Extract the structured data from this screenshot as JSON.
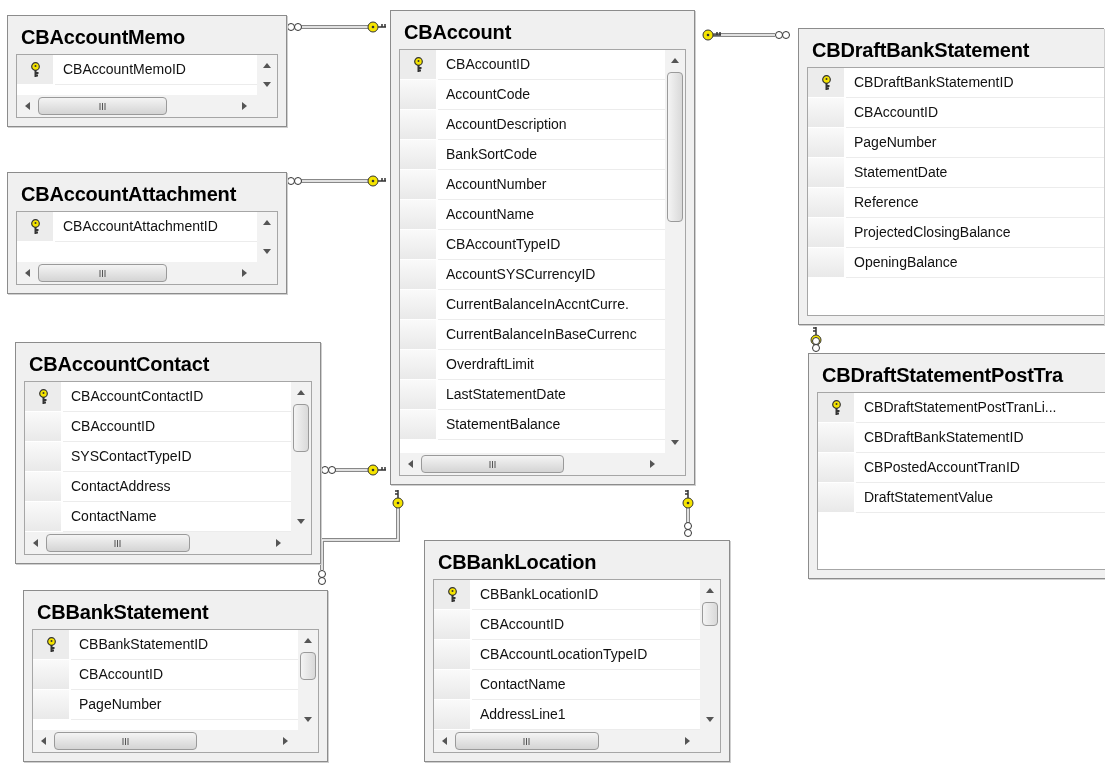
{
  "tables": [
    {
      "name": "CBAccountMemo",
      "scrollable": true,
      "columns": [
        {
          "name": "CBAccountMemoID",
          "key": true
        }
      ]
    },
    {
      "name": "CBAccountAttachment",
      "scrollable": true,
      "columns": [
        {
          "name": "CBAccountAttachmentID",
          "key": true
        }
      ]
    },
    {
      "name": "CBAccountContact",
      "scrollable": true,
      "columns": [
        {
          "name": "CBAccountContactID",
          "key": true
        },
        {
          "name": "CBAccountID",
          "key": false
        },
        {
          "name": "SYSContactTypeID",
          "key": false
        },
        {
          "name": "ContactAddress",
          "key": false
        },
        {
          "name": "ContactName",
          "key": false
        }
      ]
    },
    {
      "name": "CBBankStatement",
      "scrollable": true,
      "columns": [
        {
          "name": "CBBankStatementID",
          "key": true
        },
        {
          "name": "CBAccountID",
          "key": false
        },
        {
          "name": "PageNumber",
          "key": false
        }
      ]
    },
    {
      "name": "CBAccount",
      "scrollable": true,
      "columns": [
        {
          "name": "CBAccountID",
          "key": true
        },
        {
          "name": "AccountCode",
          "key": false
        },
        {
          "name": "AccountDescription",
          "key": false
        },
        {
          "name": "BankSortCode",
          "key": false
        },
        {
          "name": "AccountNumber",
          "key": false
        },
        {
          "name": "AccountName",
          "key": false
        },
        {
          "name": "CBAccountTypeID",
          "key": false
        },
        {
          "name": "AccountSYSCurrencyID",
          "key": false
        },
        {
          "name": "CurrentBalanceInAccntCurre.",
          "key": false
        },
        {
          "name": "CurrentBalanceInBaseCurrenc",
          "key": false
        },
        {
          "name": "OverdraftLimit",
          "key": false
        },
        {
          "name": "LastStatementDate",
          "key": false
        },
        {
          "name": "StatementBalance",
          "key": false
        }
      ]
    },
    {
      "name": "CBBankLocation",
      "scrollable": true,
      "columns": [
        {
          "name": "CBBankLocationID",
          "key": true
        },
        {
          "name": "CBAccountID",
          "key": false
        },
        {
          "name": "CBAccountLocationTypeID",
          "key": false
        },
        {
          "name": "ContactName",
          "key": false
        },
        {
          "name": "AddressLine1",
          "key": false
        }
      ]
    },
    {
      "name": "CBDraftBankStatement",
      "scrollable": false,
      "columns": [
        {
          "name": "CBDraftBankStatementID",
          "key": true
        },
        {
          "name": "CBAccountID",
          "key": false
        },
        {
          "name": "PageNumber",
          "key": false
        },
        {
          "name": "StatementDate",
          "key": false
        },
        {
          "name": "Reference",
          "key": false
        },
        {
          "name": "ProjectedClosingBalance",
          "key": false
        },
        {
          "name": "OpeningBalance",
          "key": false
        }
      ]
    },
    {
      "name": "CBDraftStatementPostTra",
      "scrollable": false,
      "columns": [
        {
          "name": "CBDraftStatementPostTranLi...",
          "key": true
        },
        {
          "name": "CBDraftBankStatementID",
          "key": false
        },
        {
          "name": "CBPostedAccountTranID",
          "key": false
        },
        {
          "name": "DraftStatementValue",
          "key": false
        }
      ]
    }
  ]
}
